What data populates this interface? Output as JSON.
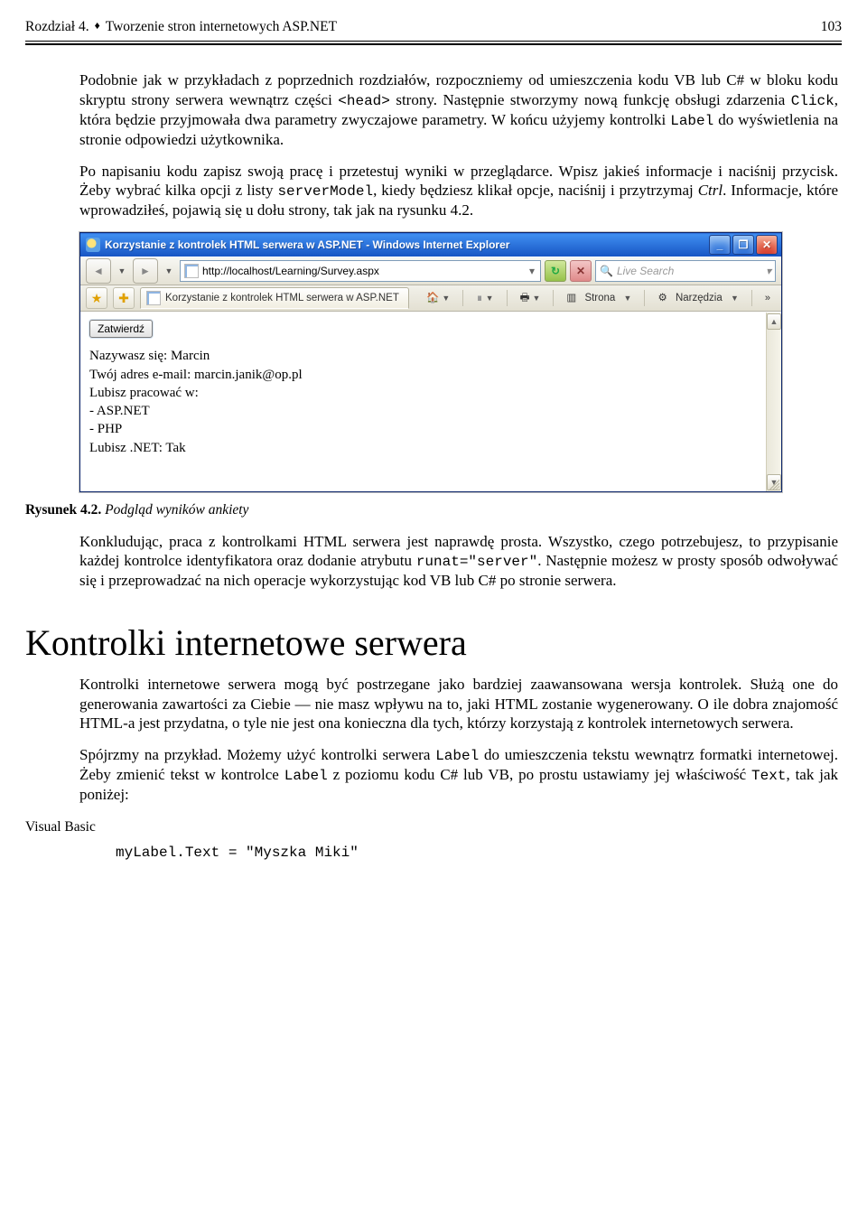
{
  "header": {
    "chapter": "Rozdział 4.",
    "title": "Tworzenie stron internetowych ASP.NET",
    "page": "103"
  },
  "p1_a": "Podobnie jak w przykładach z poprzednich rozdziałów, rozpoczniemy od umieszczenia kodu VB lub C# w bloku kodu skryptu strony serwera wewnątrz części ",
  "p1_code1": "<head>",
  "p1_b": " strony. Następnie stworzymy nową funkcję obsługi zdarzenia ",
  "p1_code2": "Click",
  "p1_c": ", która będzie przyjmowała dwa parametry zwyczajowe parametry. W końcu użyjemy kontrolki ",
  "p1_code3": "Label",
  "p1_d": " do wyświetlenia na stronie odpowiedzi użytkownika.",
  "p2_a": "Po napisaniu kodu zapisz swoją pracę i przetestuj wyniki w przeglądarce. Wpisz jakieś informacje i naciśnij przycisk. Żeby wybrać kilka opcji z listy ",
  "p2_code1": "serverModel",
  "p2_b": ", kiedy będziesz klikał opcje, naciśnij i przytrzymaj ",
  "p2_ital": "Ctrl",
  "p2_c": ". Informacje, które wprowadziłeś, pojawią się u dołu strony, tak jak na rysunku 4.2.",
  "browser": {
    "window_title": "Korzystanie z kontrolek HTML serwera w ASP.NET - Windows Internet Explorer",
    "url": "http://localhost/Learning/Survey.aspx",
    "search_placeholder": "Live Search",
    "tab_label": "Korzystanie z kontrolek HTML serwera w ASP.NET",
    "toolbar": {
      "page": "Strona",
      "tools": "Narzędzia"
    },
    "submit": "Zatwierdź",
    "lines": {
      "l1": "Nazywasz się: Marcin",
      "l2": "Twój adres e-mail: marcin.janik@op.pl",
      "l3": "Lubisz pracować w:",
      "l4": "- ASP.NET",
      "l5": "- PHP",
      "l6": "Lubisz .NET: Tak"
    }
  },
  "caption_bold": "Rysunek 4.2.",
  "caption_ital": " Podgląd wyników ankiety",
  "p3_a": "Konkludując, praca z kontrolkami HTML serwera jest naprawdę prosta. Wszystko, czego potrzebujesz, to przypisanie każdej kontrolce identyfikatora oraz dodanie atrybutu ",
  "p3_code1": "runat=\"server\"",
  "p3_b": ". Następnie możesz w prosty sposób odwoływać się i przeprowadzać na nich operacje wykorzystując kod VB lub C# po stronie serwera.",
  "h1": "Kontrolki internetowe serwera",
  "p4": "Kontrolki internetowe serwera mogą być postrzegane jako bardziej zaawansowana wersja kontrolek. Służą one do generowania zawartości za Ciebie — nie masz wpływu na to, jaki HTML zostanie wygenerowany. O ile dobra znajomość HTML-a jest przydatna, o tyle nie jest ona konieczna dla tych, którzy korzystają z kontrolek internetowych serwera.",
  "p5_a": "Spójrzmy na przykład. Możemy użyć kontrolki serwera ",
  "p5_code1": "Label",
  "p5_b": " do umieszczenia tekstu wewnątrz formatki internetowej. Żeby zmienić tekst w kontrolce ",
  "p5_code2": "Label",
  "p5_c": " z poziomu kodu C# lub VB, po prostu ustawiamy jej właściwość ",
  "p5_code3": "Text",
  "p5_d": ", tak jak poniżej:",
  "vb_label": "Visual Basic",
  "code_line": "myLabel.Text = \"Myszka Miki\""
}
